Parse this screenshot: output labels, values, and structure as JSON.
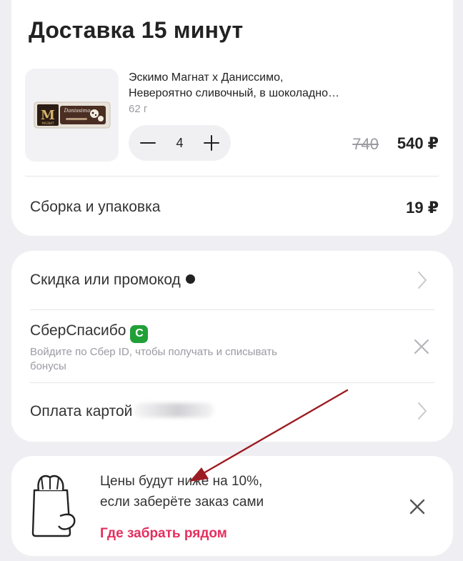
{
  "delivery": {
    "title": "Доставка 15 минут",
    "product": {
      "name_line1": "Эскимо Магнат х Даниссимо,",
      "name_line2": "Невероятно сливочный, в шоколадно…",
      "weight": "62 г",
      "quantity": "4",
      "old_price": "740",
      "price": "540 ₽",
      "thumb_brand": "M",
      "thumb_label": "MAGNAT",
      "thumb_caption": "Danissimo"
    },
    "assembly": {
      "label": "Сборка и упаковка",
      "value": "19 ₽"
    }
  },
  "payment": {
    "promo": {
      "label": "Скидка или промокод"
    },
    "sber": {
      "label": "СберСпасибо",
      "badge": "С",
      "subtitle_line1": "Войдите по Сбер ID, чтобы получать и списывать",
      "subtitle_line2": "бонусы"
    },
    "card": {
      "label": "Оплата картой"
    }
  },
  "pickup": {
    "line1": "Цены будут ниже на 10%,",
    "line2": "если заберёте заказ сами",
    "link": "Где забрать рядом"
  },
  "colors": {
    "accent_link": "#e52e5e",
    "sber_green": "#21a038",
    "annotation_arrow": "#9b1c22"
  }
}
